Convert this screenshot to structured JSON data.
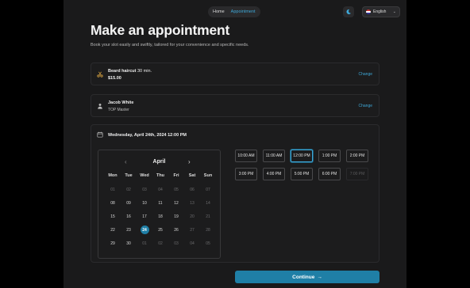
{
  "nav": {
    "home": "Home",
    "appointment": "Appointment"
  },
  "language": {
    "selected": "English"
  },
  "header": {
    "title": "Make an appointment",
    "subtitle": "Book your slot easily and swiftly, tailored for your convenience and specific needs."
  },
  "service": {
    "name": "Beard haircut",
    "duration": "30 min.",
    "price": "$15.00",
    "change_label": "Change"
  },
  "staff": {
    "name": "Jacob White",
    "role": "TOP Master",
    "change_label": "Change"
  },
  "selection": {
    "datetime": "Wednesday, April 24th, 2024 12:00 PM"
  },
  "calendar": {
    "month": "April",
    "weekdays": [
      "Mon",
      "Tue",
      "Wed",
      "Thu",
      "Fri",
      "Sat",
      "Sun"
    ],
    "days": [
      {
        "n": "01",
        "muted": true
      },
      {
        "n": "02",
        "muted": true
      },
      {
        "n": "03",
        "muted": true
      },
      {
        "n": "04",
        "muted": true
      },
      {
        "n": "05",
        "muted": true
      },
      {
        "n": "06",
        "muted": true
      },
      {
        "n": "07",
        "muted": true
      },
      {
        "n": "08"
      },
      {
        "n": "09"
      },
      {
        "n": "10"
      },
      {
        "n": "11"
      },
      {
        "n": "12"
      },
      {
        "n": "13",
        "muted": true
      },
      {
        "n": "14",
        "muted": true
      },
      {
        "n": "15"
      },
      {
        "n": "16"
      },
      {
        "n": "17"
      },
      {
        "n": "18"
      },
      {
        "n": "19"
      },
      {
        "n": "20",
        "muted": true
      },
      {
        "n": "21",
        "muted": true
      },
      {
        "n": "22"
      },
      {
        "n": "23"
      },
      {
        "n": "24",
        "selected": true
      },
      {
        "n": "25"
      },
      {
        "n": "26"
      },
      {
        "n": "27",
        "muted": true
      },
      {
        "n": "28",
        "muted": true
      },
      {
        "n": "29"
      },
      {
        "n": "30"
      },
      {
        "n": "01",
        "muted": true
      },
      {
        "n": "02",
        "muted": true
      },
      {
        "n": "03",
        "muted": true
      },
      {
        "n": "04",
        "muted": true
      },
      {
        "n": "05",
        "muted": true
      }
    ]
  },
  "time_slots": [
    {
      "label": "10:00 AM"
    },
    {
      "label": "11:00 AM"
    },
    {
      "label": "12:00 PM",
      "active": true
    },
    {
      "label": "1:00 PM"
    },
    {
      "label": "2:00 PM"
    },
    {
      "label": "3:00 PM"
    },
    {
      "label": "4:00 PM"
    },
    {
      "label": "5:00 PM"
    },
    {
      "label": "6:00 PM"
    },
    {
      "label": "7:00 PM",
      "disabled": true
    }
  ],
  "actions": {
    "continue_label": "Continue"
  },
  "colors": {
    "accent": "#3ea8d8",
    "primary_button": "#1f7fa6",
    "background": "#1a1a1b"
  }
}
